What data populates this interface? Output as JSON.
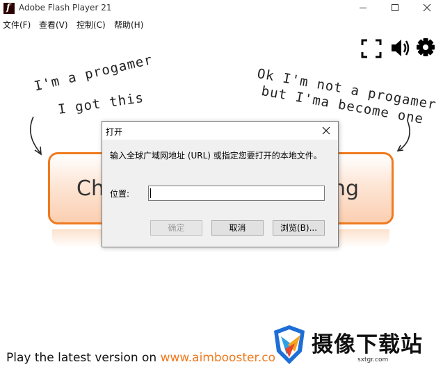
{
  "window": {
    "title": "Adobe Flash Player 21",
    "app_icon_glyph": "f"
  },
  "menu": {
    "items": [
      "文件(F)",
      "查看(V)",
      "控制(C)",
      "帮助(H)"
    ]
  },
  "content": {
    "note_left": [
      "I'm a progamer",
      "I got this"
    ],
    "note_right": [
      "Ok I'm not a progamer",
      "but I'ma become one"
    ],
    "button_left_fragment": "Ch",
    "button_right_fragment": "ng",
    "footer_prefix": "Play the latest version on ",
    "footer_link": "www.aimbooster.co",
    "accent_color": "#f07a1e"
  },
  "dialog": {
    "title": "打开",
    "prompt": "输入全球广域网地址 (URL) 或指定您要打开的本地文件。",
    "location_label": "位置:",
    "location_value": "",
    "ok_label": "确定",
    "cancel_label": "取消",
    "browse_label": "浏览(B)..."
  },
  "watermark": {
    "title": "摄像下载站",
    "url": "sxtgr.com"
  }
}
